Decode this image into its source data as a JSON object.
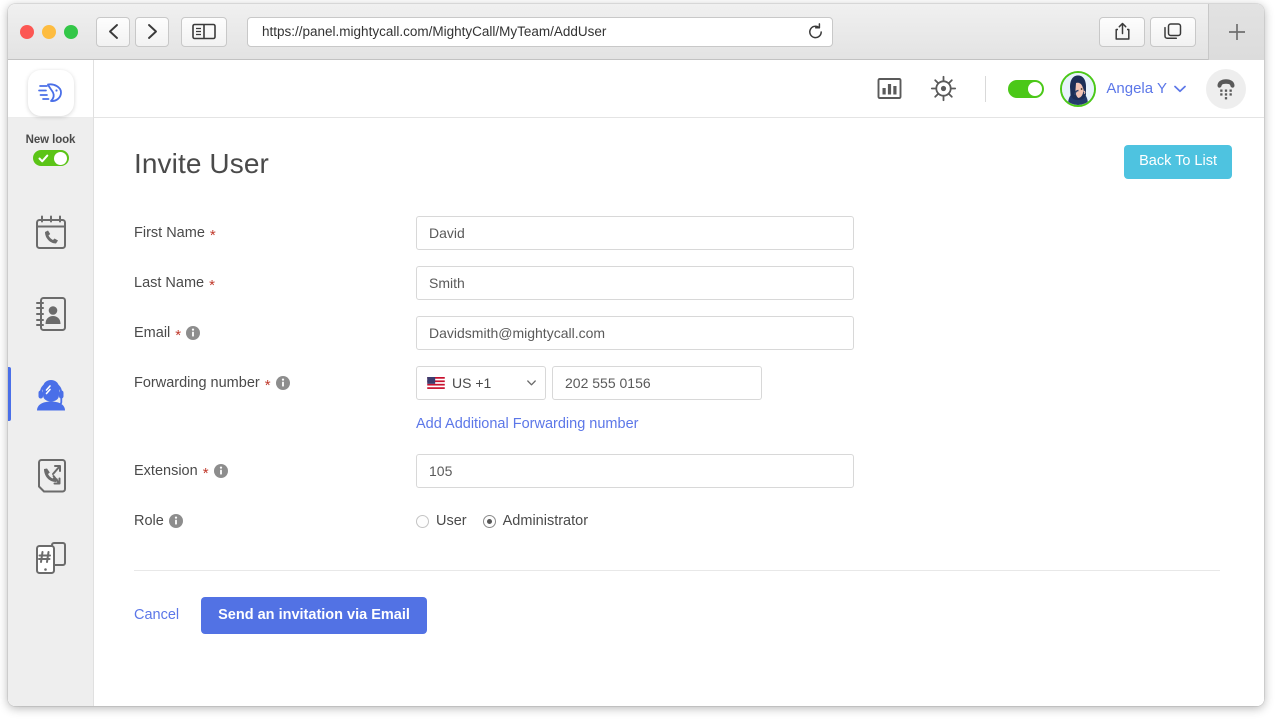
{
  "browser": {
    "url": "https://panel.mightycall.com/MightyCall/MyTeam/AddUser",
    "back_icon": "back-chevron-icon",
    "forward_icon": "forward-chevron-icon",
    "sidebar_icon": "sidebar-toggle-icon",
    "reload_icon": "reload-icon",
    "share_icon": "share-icon",
    "tabs_icon": "show-tabs-icon",
    "newtab_icon": "new-tab-plus-icon"
  },
  "rail": {
    "logo_name": "mightycall-logo",
    "new_look_label": "New look",
    "new_look_on": true,
    "items": [
      {
        "name": "call-history",
        "icon": "calendar-phone-icon",
        "active": false
      },
      {
        "name": "contacts",
        "icon": "address-book-icon",
        "active": false
      },
      {
        "name": "my-team",
        "icon": "agent-headset-icon",
        "active": true
      },
      {
        "name": "call-routing",
        "icon": "call-flow-icon",
        "active": false
      },
      {
        "name": "numbers",
        "icon": "hash-phone-icon",
        "active": false
      }
    ]
  },
  "header": {
    "reports_icon": "bar-chart-icon",
    "settings_icon": "gear-icon",
    "status_toggle_on": true,
    "avatar_name": "user-avatar",
    "user_name": "Angela Y",
    "caret_icon": "chevron-down-icon",
    "dialpad_icon": "dialpad-icon"
  },
  "main": {
    "title": "Invite User",
    "back_to_list_label": "Back To List",
    "info_icon": "info-icon",
    "required_marker": "*",
    "fields": {
      "first_name": {
        "label": "First Name",
        "value": "David",
        "required": true,
        "has_info": false
      },
      "last_name": {
        "label": "Last Name",
        "value": "Smith",
        "required": true,
        "has_info": false
      },
      "email": {
        "label": "Email",
        "value": "Davidsmith@mightycall.com",
        "required": true,
        "has_info": true
      },
      "forwarding": {
        "label": "Forwarding number",
        "required": true,
        "has_info": true,
        "country_code": "US +1",
        "flag_icon": "us-flag-icon",
        "dropdown_icon": "caret-down-icon",
        "number": "202 555 0156",
        "add_link": "Add Additional Forwarding number"
      },
      "extension": {
        "label": "Extension",
        "value": "105",
        "required": true,
        "has_info": true
      },
      "role": {
        "label": "Role",
        "required": false,
        "has_info": true,
        "options": [
          {
            "label": "User",
            "selected": false
          },
          {
            "label": "Administrator",
            "selected": true
          }
        ]
      }
    },
    "cancel_label": "Cancel",
    "submit_label": "Send an invitation via Email"
  },
  "colors": {
    "accent_blue": "#5272e4",
    "link_blue": "#5c77e8",
    "back_button_blue": "#4ec3e0",
    "toggle_green": "#4bc818",
    "required_red": "#c0392b"
  }
}
